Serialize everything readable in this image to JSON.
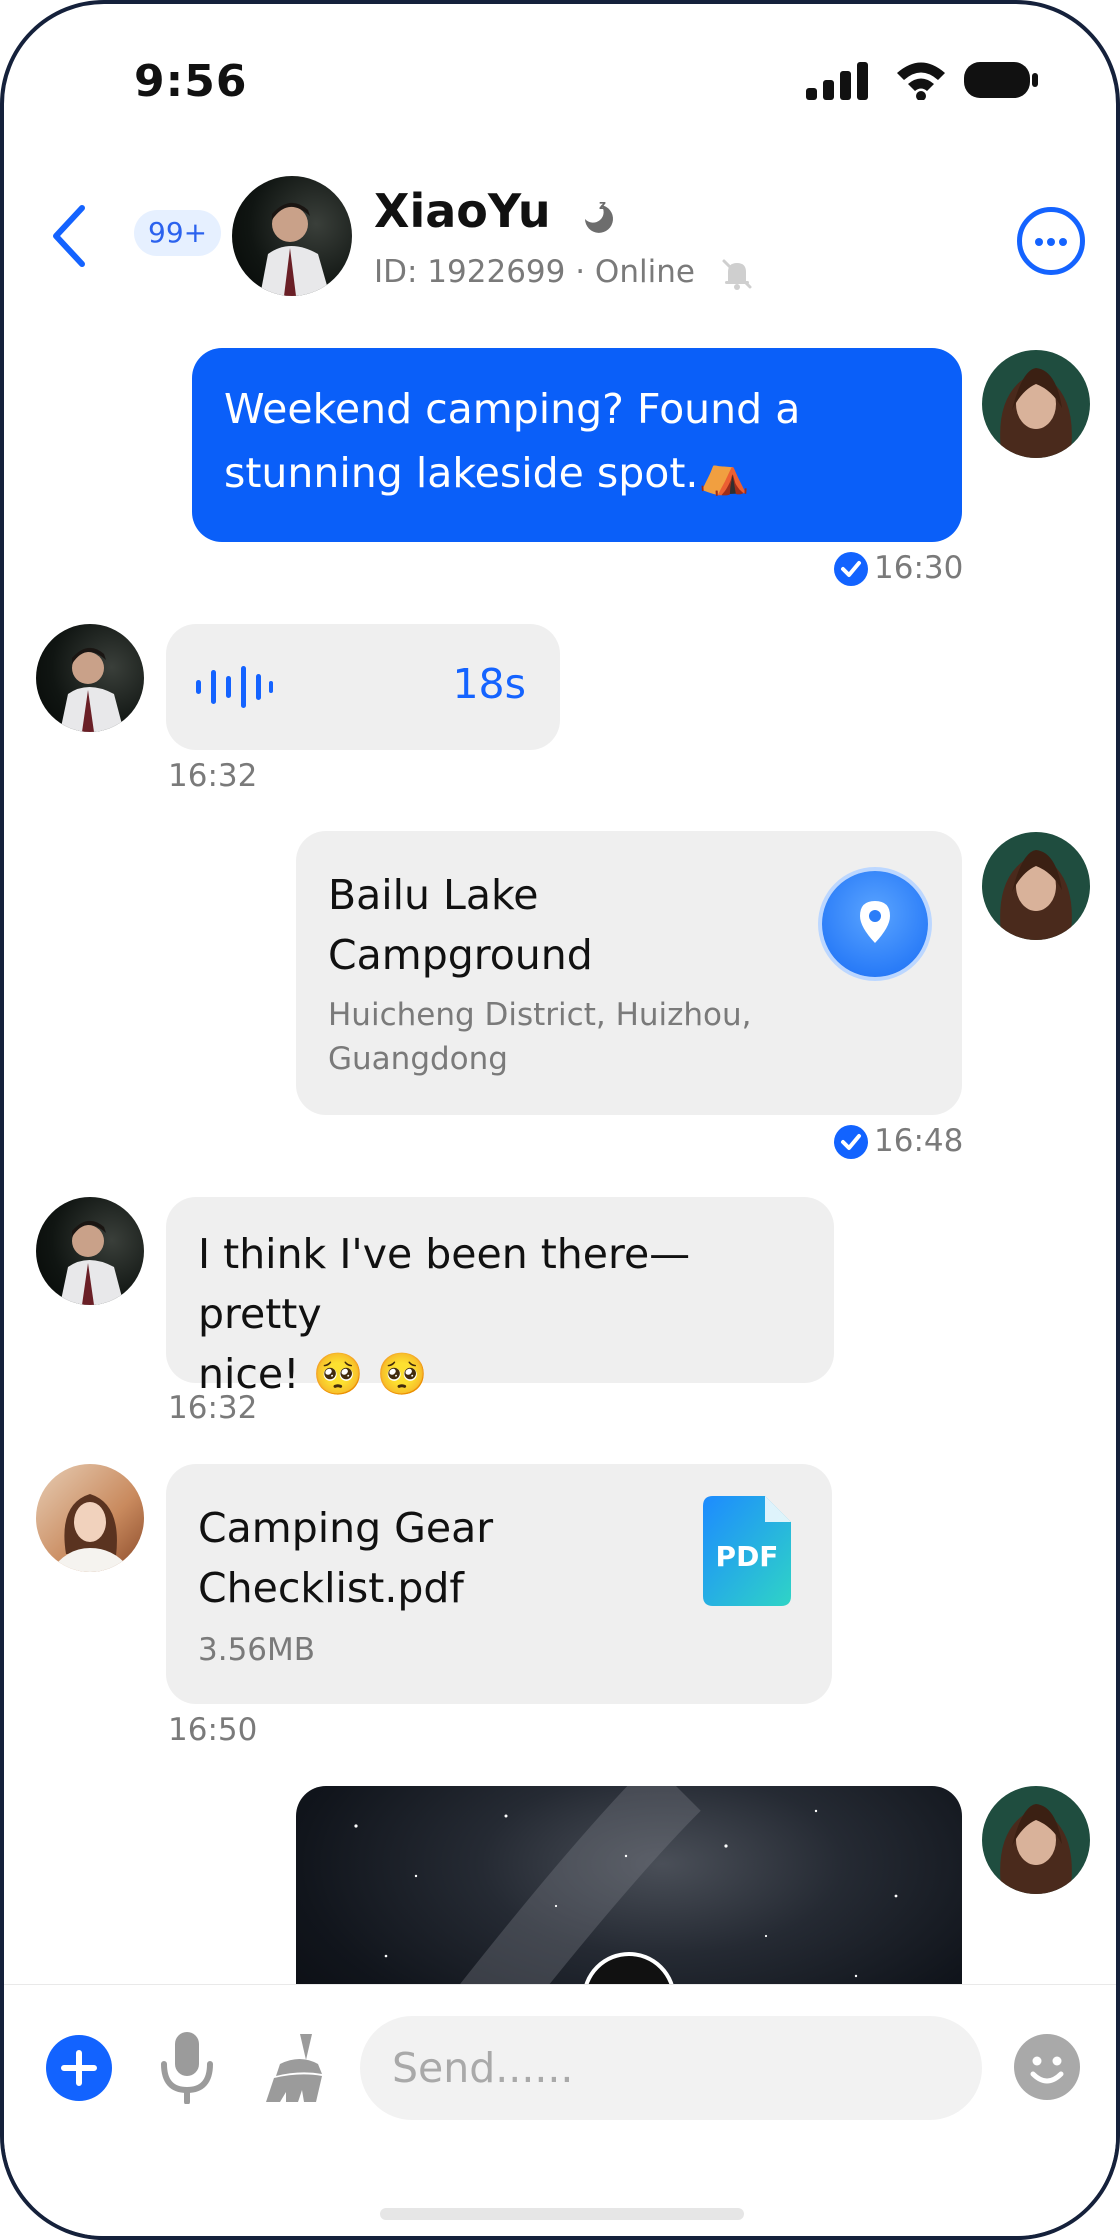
{
  "status_bar": {
    "time": "9:56"
  },
  "header": {
    "unread_count": "99+",
    "contact_name": "XiaoYu",
    "contact_status": "ID: 1922699 · Online"
  },
  "messages": [
    {
      "direction": "out",
      "type": "text",
      "text_line1": "Weekend camping? Found a",
      "text_line2": "stunning lakeside spot.⛺",
      "time": "16:30",
      "read": true
    },
    {
      "direction": "in",
      "type": "voice",
      "duration": "18s",
      "time": "16:32"
    },
    {
      "direction": "out",
      "type": "location",
      "name_line1": "Bailu Lake",
      "name_line2": "Campground",
      "address_line1": "Huicheng District, Huizhou,",
      "address_line2": "Guangdong",
      "time": "16:48",
      "read": true
    },
    {
      "direction": "in",
      "type": "text",
      "text_line1": "I think I've been there—pretty",
      "text_line2": "nice! 🥺 🥺",
      "time": "16:32"
    },
    {
      "direction": "in",
      "type": "file",
      "name_line1": "Camping Gear",
      "name_line2": "Checklist.pdf",
      "size": "3.56MB",
      "file_icon_label": "PDF",
      "time": "16:50"
    },
    {
      "direction": "out",
      "type": "image"
    }
  ],
  "composer": {
    "placeholder": "Send......"
  },
  "colors": {
    "accent": "#1263FF",
    "bubble_out": "#0A5FF9",
    "bubble_in": "#EFEFEF",
    "frame": "#15213B"
  },
  "icons": [
    "signal-icon",
    "wifi-icon",
    "battery-icon",
    "back-chevron-icon",
    "sleep-moon-icon",
    "mute-bell-icon",
    "more-icon",
    "read-check-icon",
    "voice-wave-icon",
    "location-pin-icon",
    "pdf-file-icon",
    "play-icon",
    "plus-icon",
    "microphone-icon",
    "clean-broom-icon",
    "emoji-icon"
  ]
}
